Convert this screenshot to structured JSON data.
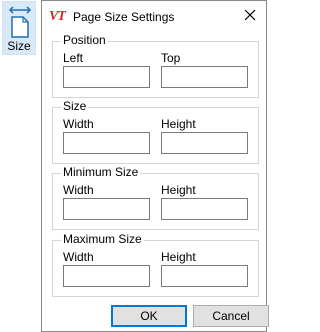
{
  "ribbon": {
    "size_label": "Size",
    "size_icon": "page-size-icon"
  },
  "dialog": {
    "title": "Page Size Settings",
    "app_icon_text": "VT",
    "close_icon": "close-icon",
    "groups": [
      {
        "title": "Position",
        "field1_label": "Left",
        "field2_label": "Top",
        "field1_value": "",
        "field2_value": ""
      },
      {
        "title": "Size",
        "field1_label": "Width",
        "field2_label": "Height",
        "field1_value": "",
        "field2_value": ""
      },
      {
        "title": "Minimum Size",
        "field1_label": "Width",
        "field2_label": "Height",
        "field1_value": "",
        "field2_value": ""
      },
      {
        "title": "Maximum Size",
        "field1_label": "Width",
        "field2_label": "Height",
        "field1_value": "",
        "field2_value": ""
      }
    ],
    "ok_label": "OK",
    "cancel_label": "Cancel"
  },
  "colors": {
    "ribbon_highlight": "#d9e9f7",
    "app_icon": "#d6262b",
    "ok_border": "#0078d7"
  }
}
